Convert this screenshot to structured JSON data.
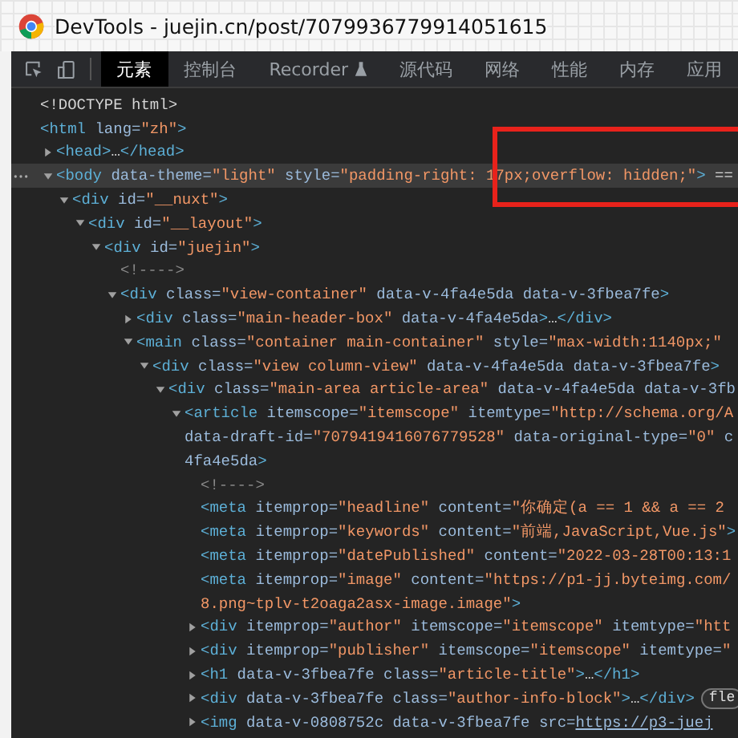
{
  "window": {
    "title": "DevTools - juejin.cn/post/7079936779914051615"
  },
  "tabs": [
    {
      "label": "元素",
      "selected": true,
      "kind": "plain"
    },
    {
      "label": "控制台",
      "selected": false,
      "kind": "plain"
    },
    {
      "label": "Recorder",
      "selected": false,
      "kind": "experimental"
    },
    {
      "label": "源代码",
      "selected": false,
      "kind": "plain"
    },
    {
      "label": "网络",
      "selected": false,
      "kind": "plain"
    },
    {
      "label": "性能",
      "selected": false,
      "kind": "plain"
    },
    {
      "label": "内存",
      "selected": false,
      "kind": "plain"
    },
    {
      "label": "应用",
      "selected": false,
      "kind": "plain"
    }
  ],
  "tree": [
    {
      "text": "<!DOCTYPE html>",
      "selected": false
    },
    {
      "text": "<html lang=\"zh\">",
      "selected": false,
      "children": [
        {
          "text": "<head>…</head>",
          "selected": false,
          "expanded": false
        },
        {
          "text": "<body data-theme=\"light\" style=\"padding-right: 17px;overflow: hidden;\"> ==",
          "selected": true,
          "expanded": true,
          "children": [
            {
              "text": "<div id=\"__nuxt\">",
              "selected": false,
              "expanded": true,
              "children": [
                {
                  "text": "<div id=\"__layout\">",
                  "selected": false,
                  "expanded": true,
                  "children": [
                    {
                      "text": "<div id=\"juejin\">",
                      "selected": false,
                      "expanded": true,
                      "children": [
                        {
                          "text": "<!---->",
                          "selected": false
                        },
                        {
                          "text": "<div class=\"view-container\" data-v-4fa4e5da data-v-3fbea7fe>",
                          "selected": false,
                          "expanded": true,
                          "children": [
                            {
                              "text": "<div class=\"main-header-box\" data-v-4fa4e5da>…</div>",
                              "selected": false,
                              "expanded": false
                            },
                            {
                              "text": "<main class=\"container main-container\" style=\"max-width:1140px;\"",
                              "selected": false,
                              "expanded": true,
                              "children": [
                                {
                                  "text": "<div class=\"view column-view\" data-v-4fa4e5da data-v-3fbea7fe>",
                                  "selected": false,
                                  "expanded": true,
                                  "children": [
                                    {
                                      "text": "<div class=\"main-area article-area\" data-v-4fa4e5da data-v-3fb",
                                      "selected": false,
                                      "expanded": true,
                                      "children": [
                                        {
                                          "text": "<article itemscope=\"itemscope\" itemtype=\"http://schema.org/A",
                                          "continued": [
                                            {
                                              "text": "data-draft-id=\"7079419416076779528\" data-original-type=\"0\" c",
                                              "open_value": false
                                            },
                                            {
                                              "text": "4fa4e5da>",
                                              "open_value": false
                                            }
                                          ],
                                          "selected": false,
                                          "expanded": true,
                                          "children": [
                                            {
                                              "text": "<!---->",
                                              "selected": false
                                            },
                                            {
                                              "text": "<meta itemprop=\"headline\" content=\"你确定(a == 1 && a == 2",
                                              "selected": false
                                            },
                                            {
                                              "text": "<meta itemprop=\"keywords\" content=\"前端,JavaScript,Vue.js\">",
                                              "selected": false
                                            },
                                            {
                                              "text": "<meta itemprop=\"datePublished\" content=\"2022-03-28T00:13:1",
                                              "selected": false
                                            },
                                            {
                                              "text": "<meta itemprop=\"image\" content=\"https://p1-jj.byteimg.com/",
                                              "continued": [
                                                {
                                                  "text": "8.png~tplv-t2oaga2asx-image.image\">",
                                                  "open_value": true
                                                }
                                              ],
                                              "selected": false
                                            },
                                            {
                                              "text": "<div itemprop=\"author\" itemscope=\"itemscope\" itemtype=\"htt",
                                              "selected": false,
                                              "expanded": false
                                            },
                                            {
                                              "text": "<div itemprop=\"publisher\" itemscope=\"itemscope\" itemtype=\"",
                                              "selected": false,
                                              "expanded": false
                                            },
                                            {
                                              "text": "<h1 data-v-3fbea7fe class=\"article-title\">…</h1>",
                                              "selected": false,
                                              "expanded": false
                                            },
                                            {
                                              "text": "<div data-v-3fbea7fe class=\"author-info-block\">…</div>",
                                              "badge": "fle",
                                              "selected": false,
                                              "expanded": false
                                            },
                                            {
                                              "text": "<img data-v-0808752c data-v-3fbea7fe src=",
                                              "link": "https://p3-juej",
                                              "selected": false,
                                              "expanded": false
                                            }
                                          ]
                                        }
                                      ]
                                    }
                                  ]
                                }
                              ]
                            }
                          ]
                        }
                      ]
                    }
                  ]
                }
              ]
            }
          ]
        }
      ]
    }
  ]
}
